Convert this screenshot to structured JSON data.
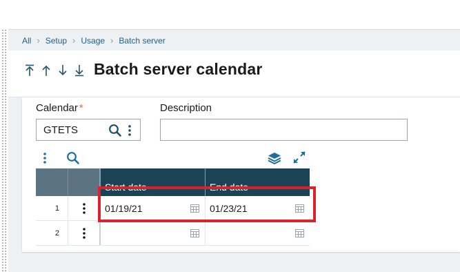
{
  "breadcrumb": [
    "All",
    "Setup",
    "Usage",
    "Batch server"
  ],
  "header": {
    "title": "Batch server calendar"
  },
  "form": {
    "calendar_label": "Calendar",
    "required_mark": "*",
    "calendar_value": "GTETS",
    "description_label": "Description",
    "description_value": ""
  },
  "grid": {
    "columns": [
      "Start date",
      "End date"
    ],
    "rows": [
      {
        "num": "1",
        "start": "01/19/21",
        "end": "01/23/21"
      },
      {
        "num": "2",
        "start": "",
        "end": ""
      }
    ]
  },
  "colors": {
    "accent": "#1b4356",
    "required": "#e8652b",
    "highlight": "#d8232a",
    "link": "#1e5e8d"
  }
}
